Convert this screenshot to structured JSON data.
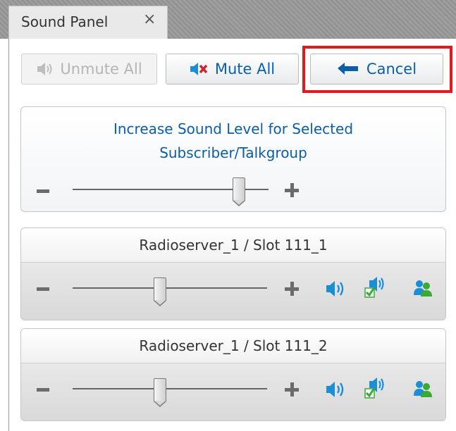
{
  "tab": {
    "title": "Sound Panel",
    "close_glyph": "×"
  },
  "toolbar": {
    "unmute_all": {
      "label": "Unmute All",
      "icon": "speaker-icon",
      "enabled": false
    },
    "mute_all": {
      "label": "Mute All",
      "icon": "speaker-muted-icon",
      "enabled": true
    },
    "cancel": {
      "label": "Cancel",
      "icon": "back-arrow-icon",
      "enabled": true,
      "highlighted": true
    }
  },
  "increase_panel": {
    "title_line1": "Increase Sound Level for Selected",
    "title_line2": "Subscriber/Talkgroup",
    "slider_level": 0.85
  },
  "subscribers": [
    {
      "name": "Radioserver_1 / Slot 111_1",
      "slider_level": 0.45,
      "actions": [
        "speaker-icon",
        "speaker-check-icon",
        "talkgroup-icon"
      ]
    },
    {
      "name": "Radioserver_1 / Slot 111_2",
      "slider_level": 0.45,
      "actions": [
        "speaker-icon",
        "speaker-check-icon",
        "talkgroup-icon"
      ]
    }
  ],
  "colors": {
    "accent_blue": "#0b5ea8",
    "highlight_red": "#e3191e",
    "icon_blue": "#1a8fd6",
    "icon_green": "#3aaa35",
    "mute_red": "#d0222a"
  }
}
